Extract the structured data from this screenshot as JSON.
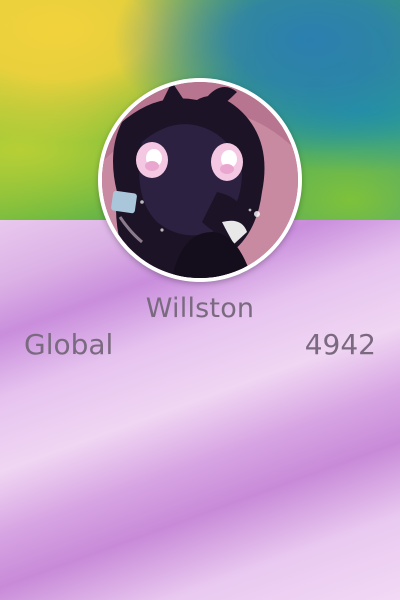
{
  "profile": {
    "username": "Willston",
    "avatar_description_icon": "character-avatar-icon"
  },
  "stat": {
    "label": "Global",
    "value": "4942"
  },
  "colors": {
    "text": "#7a6a7f",
    "avatar_border": "#ffffff",
    "body_accent": "#c98ddc"
  }
}
